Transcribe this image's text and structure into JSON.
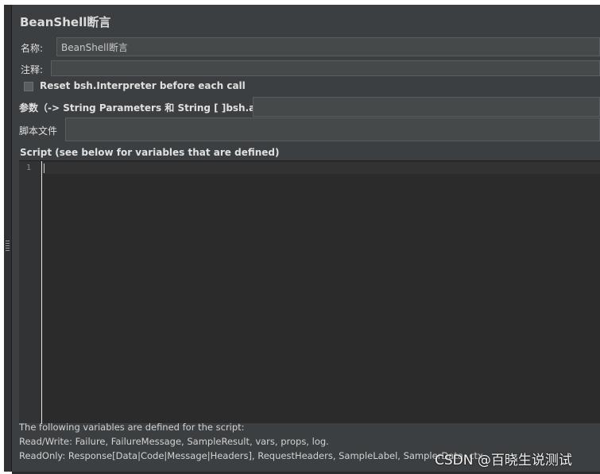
{
  "panel": {
    "title": "BeanShell断言",
    "name_label": "名称:",
    "name_value": "BeanShell断言",
    "comments_label": "注释:",
    "comments_value": "",
    "reset_label": "Reset bsh.Interpreter before each call",
    "reset_checked": false,
    "params_label": "参数（-> String Parameters 和 String [ ]bsh.args）",
    "params_value": "",
    "script_file_label": "脚本文件",
    "script_file_value": "",
    "script_section_label": "Script (see below for variables that are defined)",
    "editor": {
      "line_numbers": [
        "1"
      ],
      "content": ""
    },
    "info_lines": [
      "The following variables are defined for the script:",
      "Read/Write: Failure, FailureMessage, SampleResult, vars, props, log.",
      "ReadOnly: Response[Data|Code|Message|Headers], RequestHeaders, SampleLabel, SamplerData, ctx"
    ]
  },
  "watermark": "CSDN @百晓生说测试",
  "colors": {
    "panel_bg": "#3c3f41",
    "editor_bg": "#2b2b2b",
    "field_bg": "#45494a",
    "text": "#e0e0e0"
  }
}
